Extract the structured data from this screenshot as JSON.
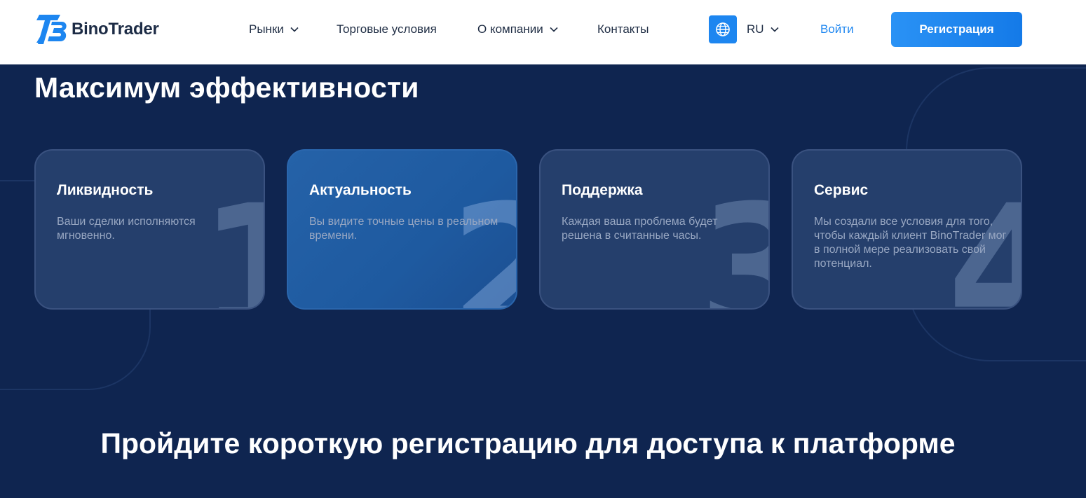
{
  "brand": {
    "name": "BinoTrader",
    "accent": "#1d86f0"
  },
  "nav": {
    "markets": "Рынки",
    "trading_conditions": "Торговые условия",
    "about": "О компании",
    "contacts": "Контакты"
  },
  "language": {
    "code": "RU",
    "icon": "globe-icon"
  },
  "auth": {
    "login": "Войти",
    "register": "Регистрация"
  },
  "section": {
    "title": "Максимум эффективности",
    "cards": [
      {
        "number": "1",
        "title": "Ликвидность",
        "text": "Ваши сделки исполняются мгновенно."
      },
      {
        "number": "2",
        "title": "Актуальность",
        "text": "Вы видите точные цены в реальном времени."
      },
      {
        "number": "3",
        "title": "Поддержка",
        "text": "Каждая ваша проблема будет решена в считанные часы."
      },
      {
        "number": "4",
        "title": "Сервис",
        "text": "Мы создали все условия для того, чтобы каждый клиент BinoTrader мог в полной мере реализовать свой потенциал."
      }
    ]
  },
  "cta": {
    "title": "Пройдите короткую регистрацию для доступа к платформе"
  },
  "colors": {
    "background": "#0f2550",
    "card": "#253f6c",
    "card_active": "#1e5aa0",
    "header": "#ffffff"
  }
}
